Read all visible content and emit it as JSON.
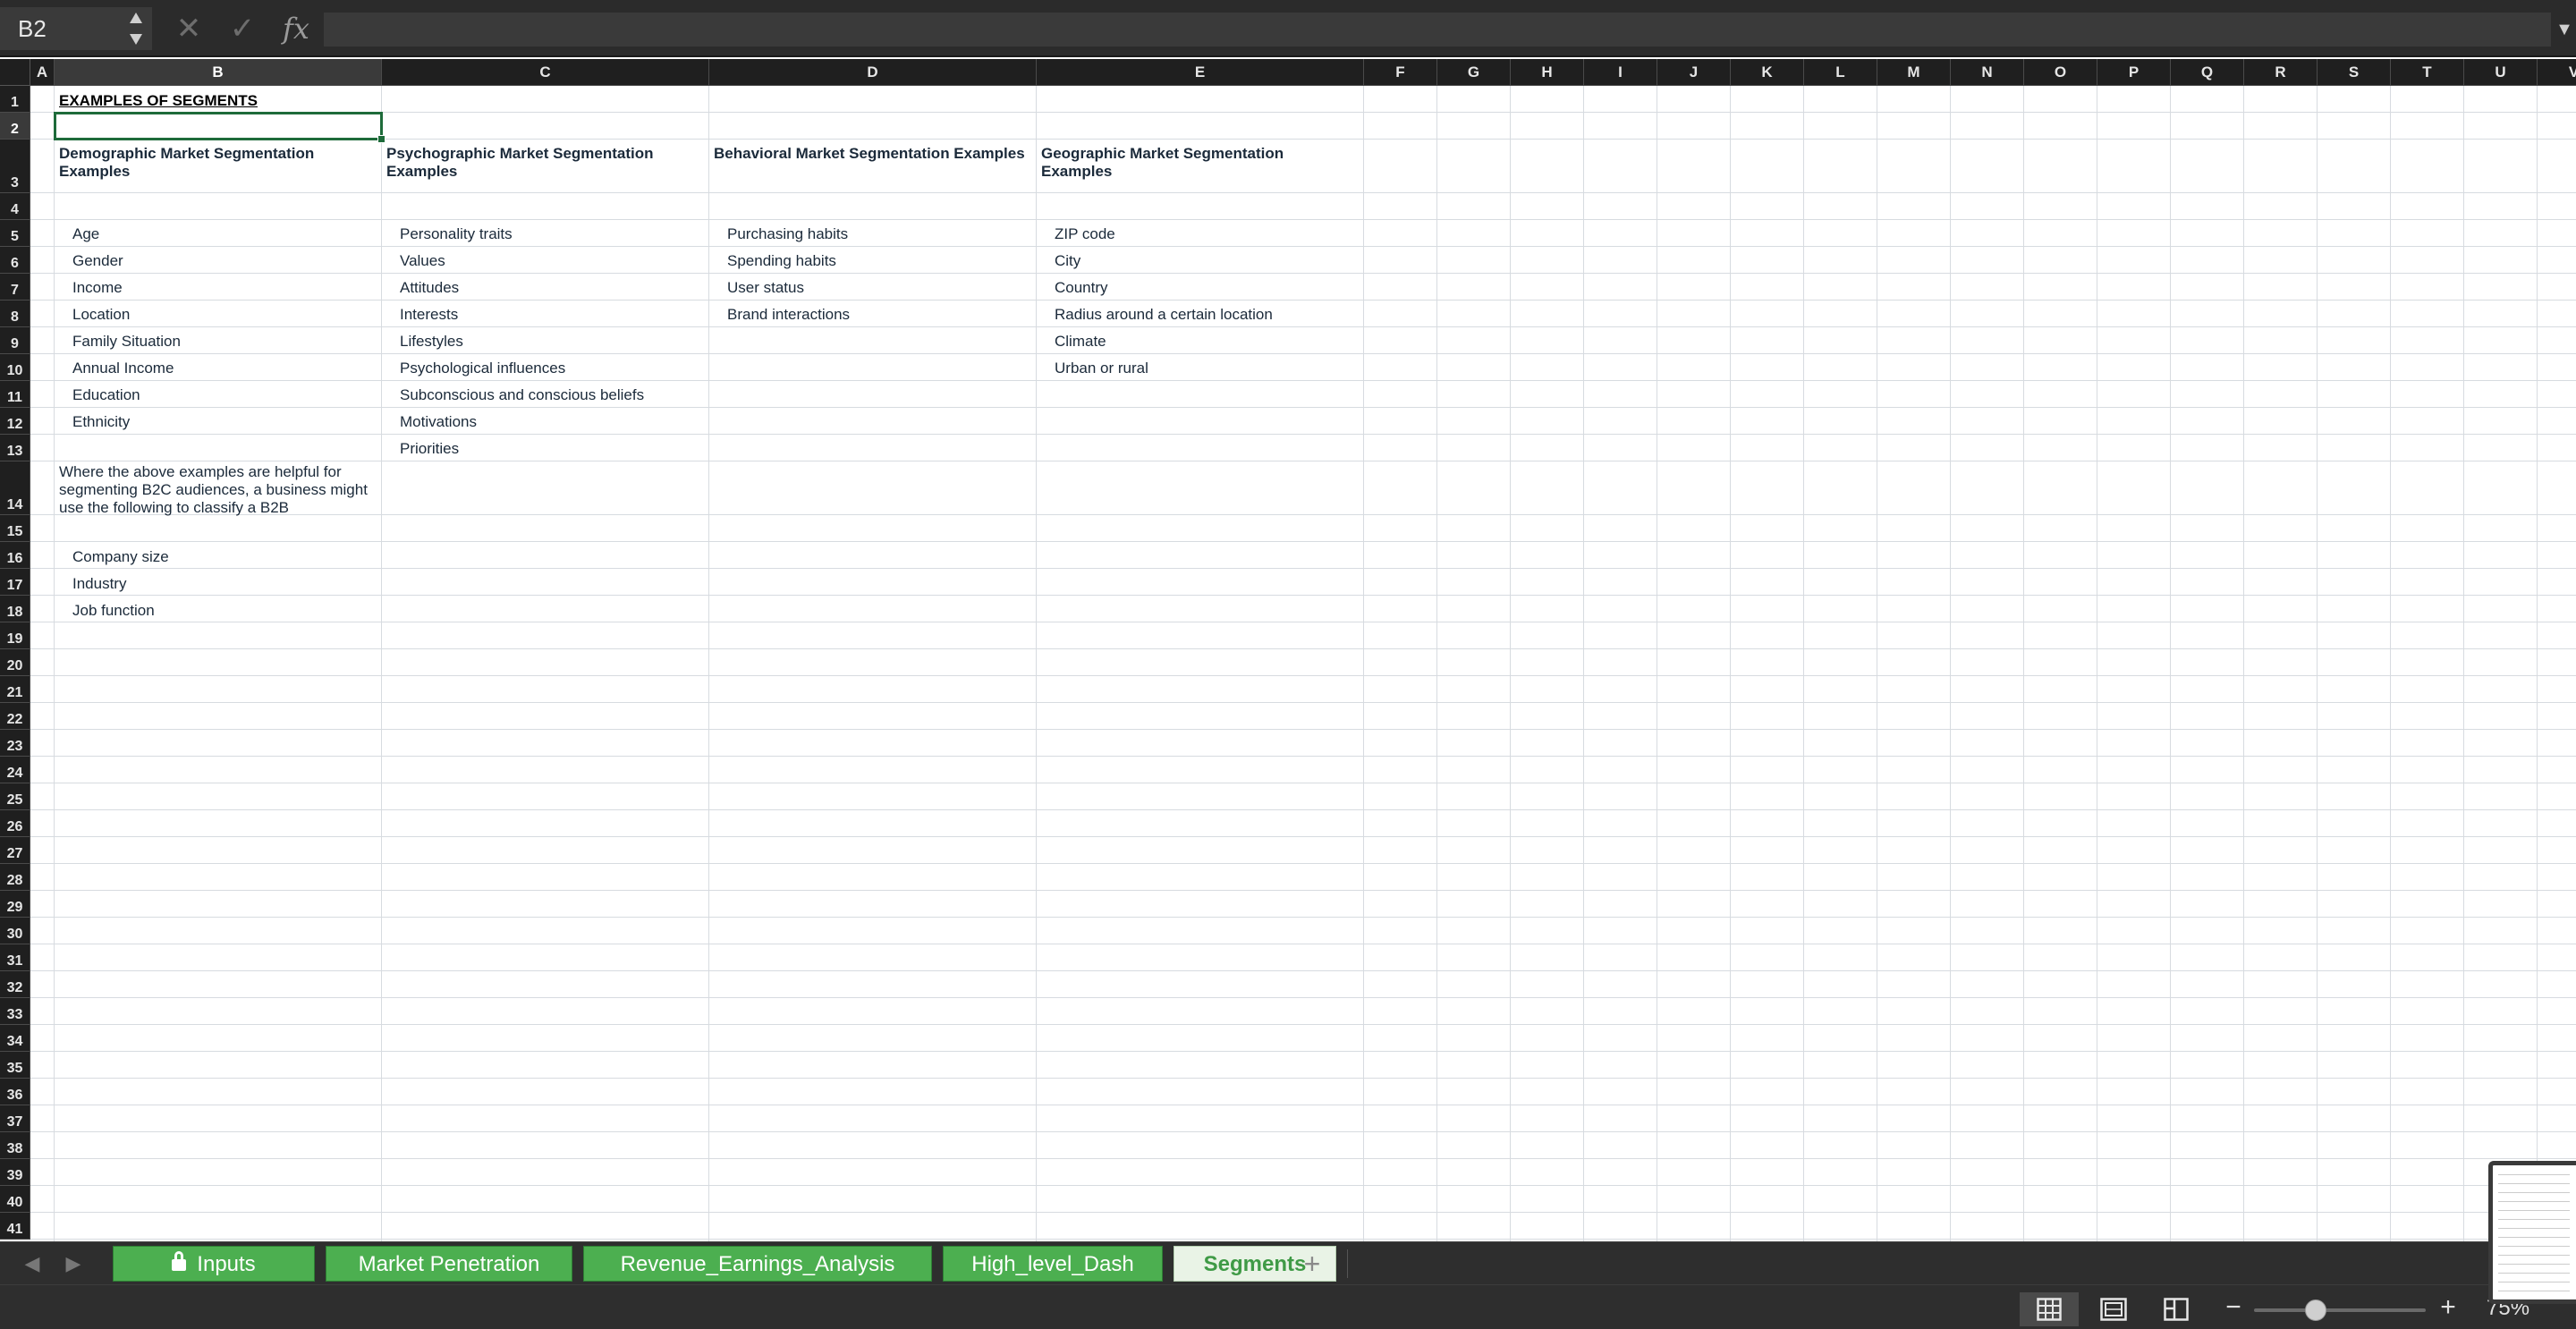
{
  "formula_bar": {
    "name_box": "B2",
    "stepper": "▲\n▼",
    "cancel_glyph": "✕",
    "confirm_glyph": "✓",
    "fx_label": "fx",
    "formula_value": "",
    "expand_glyph": "▼"
  },
  "grid": {
    "selected_cell": "B2",
    "selected_column": "B",
    "selected_row": 2,
    "columns": [
      "A",
      "B",
      "C",
      "D",
      "E",
      "F",
      "G",
      "H",
      "I",
      "J",
      "K",
      "L",
      "M",
      "N",
      "O",
      "P",
      "Q",
      "R",
      "S",
      "T",
      "U",
      "V"
    ],
    "rows": [
      1,
      2,
      3,
      4,
      5,
      6,
      7,
      8,
      9,
      10,
      11,
      12,
      13,
      14,
      15,
      16,
      17,
      18,
      19,
      20,
      21,
      22,
      23,
      24,
      25,
      26,
      27,
      28,
      29,
      30,
      31,
      32,
      33,
      34,
      35,
      36,
      37,
      38,
      39,
      40,
      41
    ],
    "cells": {
      "B1": "EXAMPLES OF SEGMENTS",
      "B3": "Demographic Market Segmentation Examples",
      "C3": "Psychographic Market Segmentation Examples",
      "D3": "Behavioral Market Segmentation Examples",
      "E3": "Geographic Market Segmentation Examples",
      "B5": "Age",
      "C5": "Personality traits",
      "D5": "Purchasing habits",
      "E5": "ZIP code",
      "B6": "Gender",
      "C6": "Values",
      "D6": "Spending habits",
      "E6": "City",
      "B7": "Income",
      "C7": "Attitudes",
      "D7": "User status",
      "E7": "Country",
      "B8": "Location",
      "C8": "Interests",
      "D8": "Brand interactions",
      "E8": "Radius around a certain location",
      "B9": "Family Situation",
      "C9": "Lifestyles",
      "E9": "Climate",
      "B10": "Annual Income",
      "C10": "Psychological influences",
      "E10": "Urban or rural",
      "B11": "Education",
      "C11": "Subconscious and conscious beliefs",
      "B12": "Ethnicity",
      "C12": "Motivations",
      "C13": "Priorities",
      "B14": "Where the above examples are helpful for segmenting B2C audiences, a business might use the following to classify a B2B",
      "B16": "Company size",
      "B17": "Industry",
      "B18": "Job function"
    }
  },
  "sheet_tabs": {
    "nav_prev": "◀",
    "nav_next": "▶",
    "add_label": "+",
    "tabs": [
      {
        "label": "Inputs",
        "locked": true,
        "active": false
      },
      {
        "label": "Market Penetration",
        "locked": false,
        "active": false
      },
      {
        "label": "Revenue_Earnings_Analysis",
        "locked": false,
        "active": false
      },
      {
        "label": "High_level_Dash",
        "locked": false,
        "active": false
      },
      {
        "label": "Segments",
        "locked": false,
        "active": true
      }
    ]
  },
  "status_bar": {
    "views": [
      {
        "name": "normal-view-icon",
        "active": true
      },
      {
        "name": "page-layout-view-icon",
        "active": false
      },
      {
        "name": "page-break-view-icon",
        "active": false
      }
    ],
    "zoom_minus": "−",
    "zoom_plus": "+",
    "zoom_level": "75%",
    "zoom_slider_fraction": 0.36
  },
  "colors": {
    "tab_green": "#4caf50",
    "selection_green": "#1e6b3a",
    "header_dark": "#1f1f1f"
  }
}
